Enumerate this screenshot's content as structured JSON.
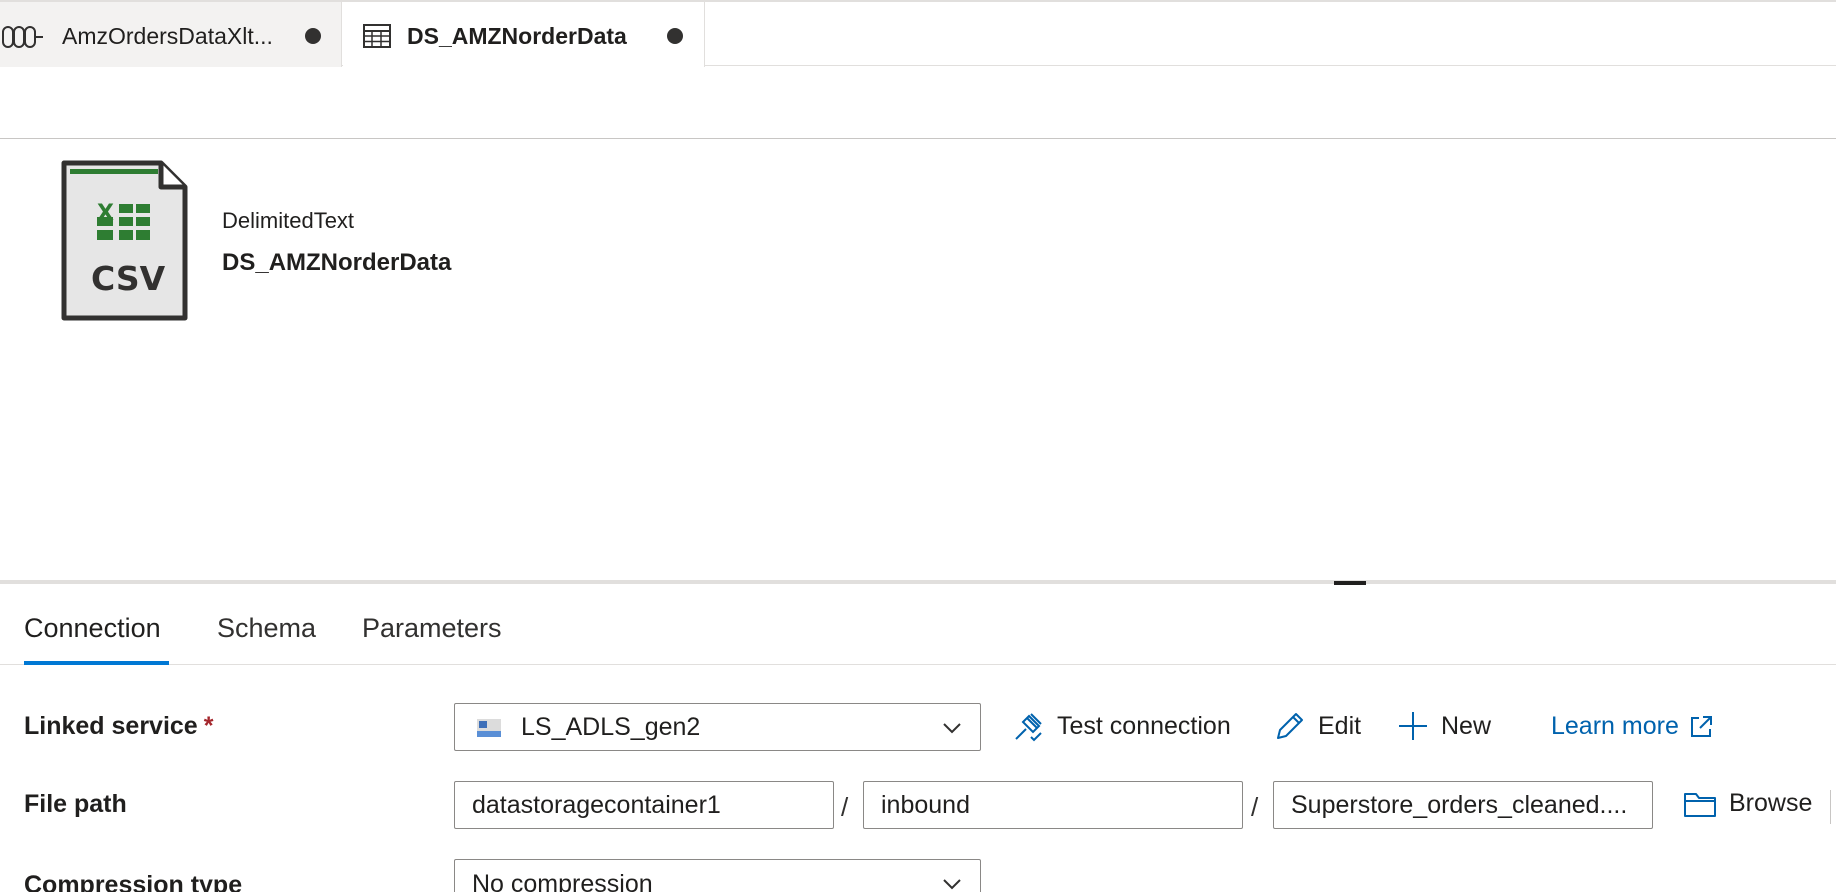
{
  "tabs": [
    {
      "label": "AmzOrdersDataXlt...",
      "icon": "pipeline-icon",
      "active": false,
      "unsaved": true
    },
    {
      "label": "DS_AMZNorderData",
      "icon": "table-icon",
      "active": true,
      "unsaved": true
    }
  ],
  "dataset": {
    "icon_text": "CSV",
    "type": "DelimitedText",
    "name": "DS_AMZNorderData"
  },
  "property_tabs": [
    {
      "label": "Connection",
      "active": true
    },
    {
      "label": "Schema",
      "active": false
    },
    {
      "label": "Parameters",
      "active": false
    }
  ],
  "form": {
    "linked_service": {
      "label": "Linked service",
      "required_mark": "*",
      "value": "LS_ADLS_gen2",
      "test_connection": "Test connection",
      "edit": "Edit",
      "new": "New",
      "learn_more": "Learn more"
    },
    "file_path": {
      "label": "File path",
      "container": "datastoragecontainer1",
      "directory": "inbound",
      "file": "Superstore_orders_cleaned....",
      "separator": "/",
      "browse": "Browse"
    },
    "compression_type": {
      "label": "Compression type",
      "value": "No compression"
    }
  },
  "colors": {
    "accent": "#0078d4",
    "link": "#0062ad",
    "required": "#a4262c",
    "csv_green": "#2e7d32"
  }
}
